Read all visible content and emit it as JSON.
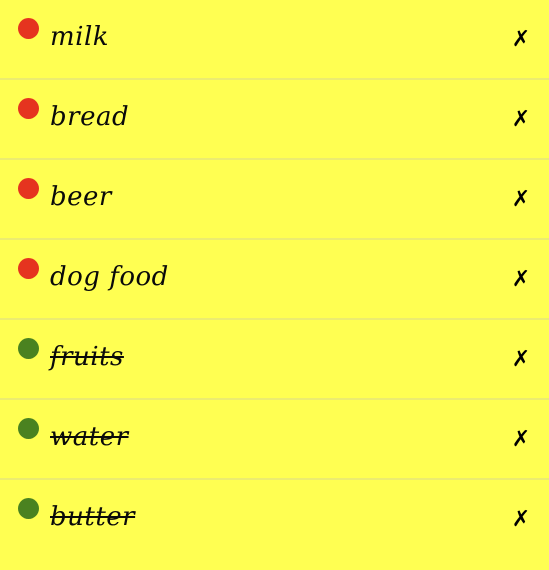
{
  "items": [
    {
      "label": "milk",
      "done": false,
      "status_color": "#e5341f",
      "remove_icon": "✗"
    },
    {
      "label": "bread",
      "done": false,
      "status_color": "#e5341f",
      "remove_icon": "✗"
    },
    {
      "label": "beer",
      "done": false,
      "status_color": "#e5341f",
      "remove_icon": "✗"
    },
    {
      "label": "dog food",
      "done": false,
      "status_color": "#e5341f",
      "remove_icon": "✗"
    },
    {
      "label": "fruits",
      "done": true,
      "status_color": "#4a8220",
      "remove_icon": "✗"
    },
    {
      "label": "water",
      "done": true,
      "status_color": "#4a8220",
      "remove_icon": "✗"
    },
    {
      "label": "butter",
      "done": true,
      "status_color": "#4a8220",
      "remove_icon": "✗"
    }
  ],
  "colors": {
    "background": "#ffff52",
    "pending": "#e5341f",
    "done": "#4a8220"
  }
}
